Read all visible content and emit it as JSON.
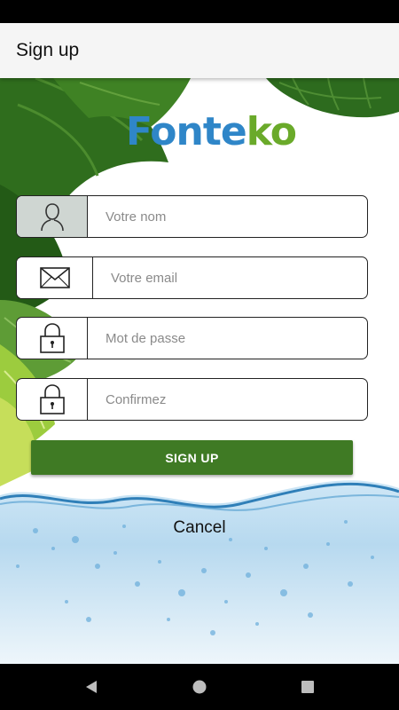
{
  "app_bar": {
    "title": "Sign up"
  },
  "logo": {
    "text_main": "Fonte",
    "text_accent": "ko"
  },
  "form": {
    "name": {
      "placeholder": "Votre nom",
      "icon": "user-icon"
    },
    "email": {
      "placeholder": "Votre email",
      "icon": "envelope-icon"
    },
    "password": {
      "placeholder": "Mot de passe",
      "icon": "lock-icon"
    },
    "confirm": {
      "placeholder": "Confirmez",
      "icon": "lock-icon"
    }
  },
  "actions": {
    "signup_label": "SIGN UP",
    "cancel_label": "Cancel"
  },
  "colors": {
    "primary_button": "#3f7a24",
    "logo_blue": "#2f86c8",
    "logo_green": "#6aaa2a",
    "app_bar": "#f5f5f5"
  },
  "nav": {
    "back": "back-icon",
    "home": "home-icon",
    "recents": "recents-icon"
  }
}
